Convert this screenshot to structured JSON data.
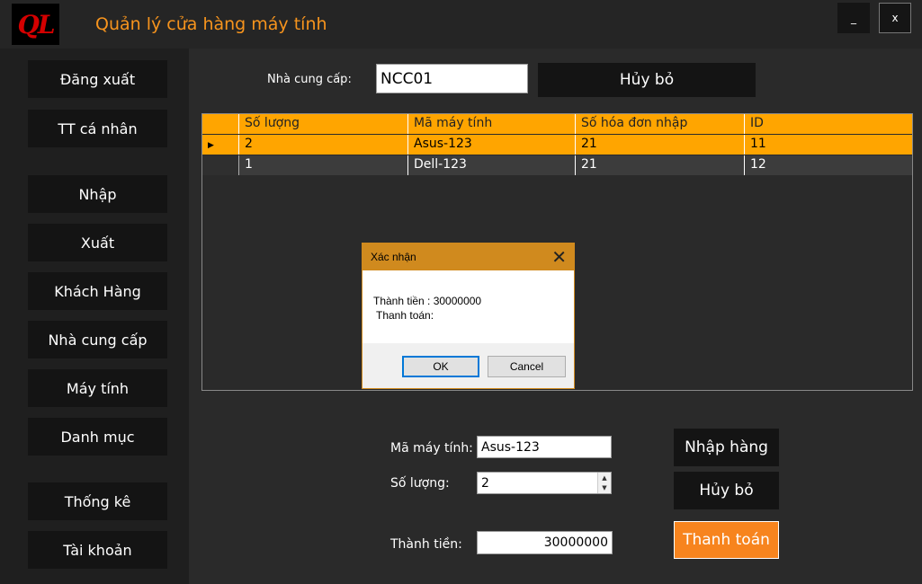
{
  "app": {
    "logo": "QL",
    "title": "Quản lý cửa hàng máy tính",
    "minimize": "_",
    "close": "x"
  },
  "sidebar": {
    "items": [
      {
        "label": "Đăng xuất"
      },
      {
        "label": "TT cá nhân"
      },
      {
        "label": "Nhập"
      },
      {
        "label": "Xuất"
      },
      {
        "label": "Khách Hàng"
      },
      {
        "label": "Nhà cung cấp"
      },
      {
        "label": "Máy tính"
      },
      {
        "label": "Danh mục"
      },
      {
        "label": "Thống kê"
      },
      {
        "label": "Tài khoản"
      }
    ]
  },
  "supplier": {
    "label": "Nhà cung cấp:",
    "value": "NCC01",
    "cancel_label": "Hủy bỏ"
  },
  "grid": {
    "columns": [
      "Số lượng",
      "Mã máy tính",
      "Số hóa đơn nhập",
      "ID"
    ],
    "rows": [
      [
        "2",
        "Asus-123",
        "21",
        "11"
      ],
      [
        "1",
        "Dell-123",
        "21",
        "12"
      ]
    ],
    "selected_row_marker": "▶"
  },
  "dialog": {
    "title": "Xác nhận",
    "close": "✕",
    "line1": "Thành tiền : 30000000",
    "line2": "Thanh toán:",
    "ok_label": "OK",
    "cancel_label": "Cancel"
  },
  "form": {
    "computer_code_label": "Mã máy tính:",
    "computer_code_value": "Asus-123",
    "quantity_label": "Số lượng:",
    "quantity_value": "2",
    "total_label": "Thành tiền:",
    "total_value": "30000000"
  },
  "actions": {
    "import_label": "Nhập hàng",
    "cancel_label": "Hủy bỏ",
    "pay_label": "Thanh toán"
  },
  "colors": {
    "accent": "#f7941d",
    "grid_highlight": "#ffa500",
    "dialog_title": "#d08a1e"
  }
}
